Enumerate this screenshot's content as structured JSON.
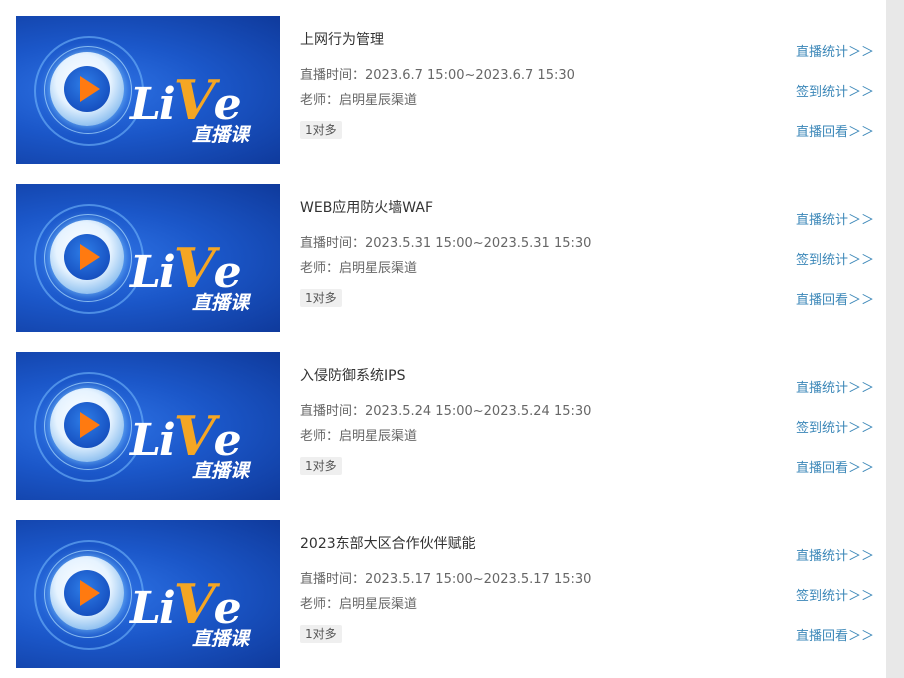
{
  "thumbnail": {
    "live_text": "LiVe",
    "course_text": "直播课",
    "colors": {
      "blue": "#1b57c9",
      "orange": "#ff7a10",
      "gold": "#f5a623"
    }
  },
  "time_label": "直播时间：",
  "teacher_label": "老师：",
  "links": {
    "live_stats": "直播统计＞＞",
    "signin_stats": "签到统计＞＞",
    "replay": "直播回看＞＞"
  },
  "courses": [
    {
      "title": "上网行为管理",
      "time": "2023.6.7 15:00~2023.6.7 15:30",
      "teacher": "启明星辰渠道",
      "tag": "1对多"
    },
    {
      "title": "WEB应用防火墙WAF",
      "time": "2023.5.31 15:00~2023.5.31 15:30",
      "teacher": "启明星辰渠道",
      "tag": "1对多"
    },
    {
      "title": "入侵防御系统IPS",
      "time": "2023.5.24 15:00~2023.5.24 15:30",
      "teacher": "启明星辰渠道",
      "tag": "1对多"
    },
    {
      "title": "2023东部大区合作伙伴赋能",
      "time": "2023.5.17 15:00~2023.5.17 15:30",
      "teacher": "启明星辰渠道",
      "tag": "1对多"
    }
  ]
}
